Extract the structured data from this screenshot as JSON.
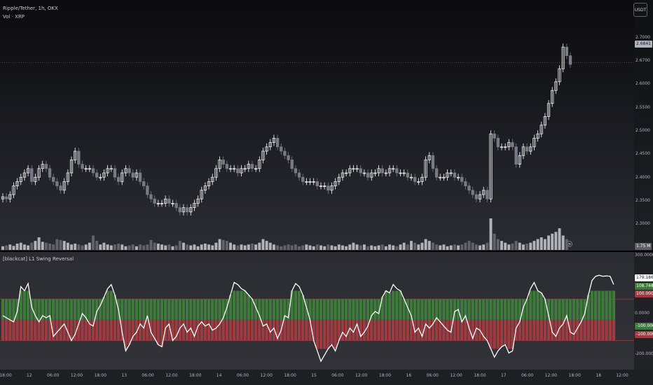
{
  "header": {
    "symbol_title": "Ripple/Tether, 1h, OKX",
    "volume_label": "Vol · XRP",
    "indicator_label": "[blackcat] L1 Swing Reversal",
    "currency_button": "USDT"
  },
  "price_axis": {
    "ticks": [
      "2.7000",
      "2.6700",
      "2.6000",
      "2.5500",
      "2.5000",
      "2.4500",
      "2.4000",
      "2.3500",
      "2.3000"
    ],
    "last_price_tag": "2.6841",
    "volume_tag": "1.75 M"
  },
  "indicator_axis": {
    "ticks": [
      "300.0000",
      "0.0000",
      "-200.0000"
    ],
    "tags": [
      "179.1865",
      "108.7487",
      "100.0000",
      "-100.0000",
      "-100.0000"
    ]
  },
  "time_axis": {
    "ticks": [
      "18:00",
      "12",
      "06:00",
      "12:00",
      "18:00",
      "13",
      "06:00",
      "12:00",
      "18:00",
      "14",
      "06:00",
      "12:00",
      "18:00",
      "15",
      "06:00",
      "12:00",
      "18:00",
      "16",
      "06:00",
      "12:00",
      "18:00",
      "17",
      "06:00",
      "12:00",
      "18:00",
      "18",
      "12:00"
    ]
  },
  "icons": {
    "reset": "reset-scale-icon"
  },
  "colors": {
    "up": "#ffffff",
    "down": "#787b86",
    "histogram_positive": "#3f7a3c",
    "histogram_negative": "#9e3b41",
    "oscillator_line": "#ffffff"
  },
  "chart_data": [
    {
      "type": "candlestick",
      "title": "Ripple/Tether, 1h, OKX",
      "ylim": [
        2.28,
        2.78
      ],
      "closes": [
        2.375,
        2.37,
        2.38,
        2.4,
        2.41,
        2.42,
        2.43,
        2.44,
        2.41,
        2.42,
        2.44,
        2.45,
        2.44,
        2.42,
        2.41,
        2.4,
        2.39,
        2.41,
        2.43,
        2.46,
        2.48,
        2.45,
        2.44,
        2.44,
        2.44,
        2.43,
        2.42,
        2.42,
        2.43,
        2.44,
        2.44,
        2.42,
        2.41,
        2.43,
        2.44,
        2.43,
        2.42,
        2.43,
        2.41,
        2.4,
        2.38,
        2.37,
        2.36,
        2.36,
        2.36,
        2.37,
        2.36,
        2.36,
        2.35,
        2.34,
        2.35,
        2.34,
        2.35,
        2.36,
        2.37,
        2.39,
        2.4,
        2.41,
        2.42,
        2.44,
        2.46,
        2.45,
        2.44,
        2.44,
        2.44,
        2.43,
        2.44,
        2.44,
        2.45,
        2.44,
        2.44,
        2.46,
        2.48,
        2.49,
        2.5,
        2.51,
        2.49,
        2.48,
        2.47,
        2.46,
        2.44,
        2.43,
        2.42,
        2.41,
        2.41,
        2.41,
        2.41,
        2.4,
        2.4,
        2.4,
        2.39,
        2.4,
        2.41,
        2.42,
        2.43,
        2.43,
        2.44,
        2.44,
        2.44,
        2.43,
        2.43,
        2.42,
        2.43,
        2.43,
        2.44,
        2.43,
        2.43,
        2.44,
        2.44,
        2.43,
        2.43,
        2.43,
        2.42,
        2.42,
        2.41,
        2.41,
        2.42,
        2.46,
        2.47,
        2.44,
        2.42,
        2.42,
        2.42,
        2.43,
        2.43,
        2.42,
        2.42,
        2.41,
        2.4,
        2.39,
        2.38,
        2.37,
        2.38,
        2.39,
        2.37,
        2.52,
        2.51,
        2.49,
        2.49,
        2.49,
        2.5,
        2.49,
        2.45,
        2.47,
        2.49,
        2.48,
        2.49,
        2.51,
        2.52,
        2.54,
        2.56,
        2.59,
        2.62,
        2.64,
        2.67,
        2.72,
        2.7,
        2.68
      ]
    },
    {
      "type": "bar",
      "title": "Vol · XRP",
      "values": [
        0.2,
        0.25,
        0.3,
        0.22,
        0.35,
        0.4,
        0.3,
        0.25,
        0.4,
        0.5,
        0.7,
        0.45,
        0.4,
        0.35,
        0.3,
        0.6,
        0.55,
        0.5,
        0.4,
        0.3,
        0.35,
        0.3,
        0.25,
        0.3,
        0.4,
        0.8,
        0.5,
        0.3,
        0.4,
        0.3,
        0.25,
        0.3,
        0.35,
        0.3,
        0.2,
        0.25,
        0.3,
        0.2,
        0.3,
        0.25,
        0.3,
        0.55,
        0.4,
        0.35,
        0.3,
        0.25,
        0.3,
        0.2,
        0.25,
        0.5,
        0.4,
        0.3,
        0.25,
        0.3,
        0.2,
        0.3,
        0.35,
        0.3,
        0.25,
        0.4,
        0.6,
        0.55,
        0.5,
        0.4,
        0.3,
        0.25,
        0.3,
        0.25,
        0.3,
        0.35,
        0.3,
        0.4,
        0.6,
        0.5,
        0.4,
        0.3,
        0.25,
        0.2,
        0.25,
        0.3,
        0.25,
        0.3,
        0.2,
        0.25,
        0.3,
        0.25,
        0.2,
        0.3,
        0.25,
        0.2,
        0.3,
        0.25,
        0.2,
        0.3,
        0.25,
        0.2,
        0.3,
        0.4,
        0.3,
        0.25,
        0.3,
        0.2,
        0.25,
        0.2,
        0.25,
        0.3,
        0.2,
        0.3,
        0.25,
        0.2,
        0.3,
        0.4,
        0.3,
        0.5,
        0.4,
        0.3,
        0.4,
        0.6,
        0.5,
        0.4,
        0.3,
        0.25,
        0.3,
        0.2,
        0.25,
        0.3,
        0.25,
        0.3,
        0.4,
        0.5,
        0.4,
        0.3,
        0.25,
        0.3,
        0.4,
        1.75,
        0.9,
        0.6,
        0.5,
        0.4,
        0.3,
        0.35,
        0.5,
        0.4,
        0.3,
        0.35,
        0.4,
        0.5,
        0.6,
        0.7,
        0.6,
        0.8,
        0.9,
        1.0,
        1.2,
        0.8,
        0.6
      ]
    },
    {
      "type": "line",
      "title": "[blackcat] L1 Swing Reversal",
      "ylim": [
        -230,
        300
      ],
      "oscillator": [
        20,
        10,
        0,
        -10,
        40,
        160,
        140,
        175,
        60,
        20,
        -10,
        20,
        10,
        20,
        -80,
        -60,
        -40,
        -20,
        -60,
        -100,
        -70,
        -20,
        30,
        10,
        -20,
        -30,
        40,
        70,
        110,
        150,
        170,
        120,
        50,
        -60,
        -150,
        -120,
        -80,
        -60,
        -20,
        -40,
        20,
        -60,
        -90,
        -120,
        -130,
        -40,
        -20,
        -100,
        -80,
        -40,
        -20,
        -60,
        -40,
        -80,
        -30,
        -10,
        -30,
        -20,
        -50,
        -40,
        -20,
        10,
        60,
        120,
        180,
        170,
        150,
        140,
        120,
        100,
        60,
        20,
        -30,
        -20,
        -60,
        -40,
        -90,
        -50,
        20,
        10,
        140,
        175,
        160,
        120,
        60,
        0,
        -100,
        -150,
        -200,
        -170,
        -140,
        -120,
        -150,
        -100,
        -60,
        -80,
        -40,
        -60,
        -20,
        -80,
        -60,
        -30,
        20,
        40,
        30,
        110,
        140,
        130,
        170,
        150,
        140,
        100,
        60,
        20,
        -60,
        -40,
        -80,
        -20,
        -40,
        -20,
        10,
        -10,
        -30,
        -50,
        -60,
        40,
        50,
        -10,
        20,
        -40,
        -90,
        -40,
        -50,
        -80,
        -100,
        -140,
        -180,
        -150,
        -130,
        -120,
        -160,
        -150,
        -40,
        -10,
        60,
        100,
        150,
        180,
        140,
        130,
        100,
        20,
        -60,
        -80,
        -40,
        -20,
        20,
        -60,
        -70,
        -40,
        -10,
        30,
        120,
        190,
        210,
        215,
        210,
        212,
        210,
        170
      ]
    }
  ]
}
